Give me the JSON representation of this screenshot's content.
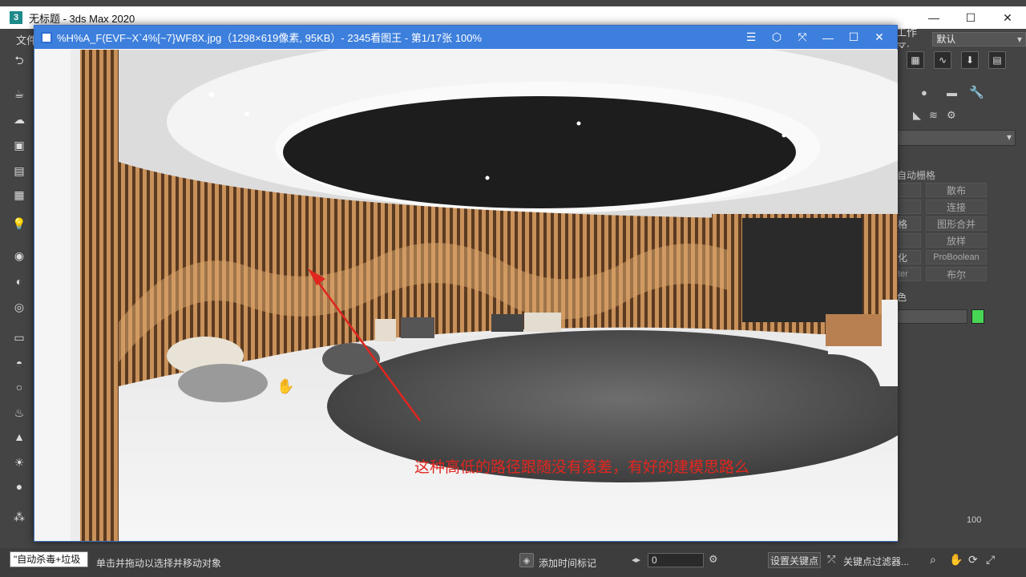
{
  "max_window": {
    "title": "无标题 - 3ds Max 2020",
    "app_icon": "3",
    "menu_first": "文件",
    "workspace_label": "工作区:",
    "workspace_value": "默认",
    "window_buttons": {
      "minimize": "—",
      "maximize": "☐",
      "close": "✕"
    }
  },
  "right_panel": {
    "auto_grid": "自动栅格",
    "buttons": [
      {
        "left": "",
        "right": "散布"
      },
      {
        "left": "",
        "right": "连接"
      },
      {
        "left": "格",
        "right": "图形合并"
      },
      {
        "left": "",
        "right": "放样"
      },
      {
        "left": "化",
        "right": "ProBoolean"
      },
      {
        "left": "ter",
        "right": "布尔"
      }
    ],
    "color_label": "色",
    "color_swatch": "#47d654",
    "timeline_end": "100"
  },
  "status_bar": {
    "script_listener": "\"自动杀毒+垃圾",
    "prompt": "单击并拖动以选择并移动对象",
    "add_time_tag": "添加时间标记",
    "frame_value": "0",
    "set_key": "设置关键点",
    "key_filters": "关键点过滤器..."
  },
  "viewer": {
    "title": "%H%A_F(EVF~X`4%[~7}WF8X.jpg（1298×619像素, 95KB）- 2345看图王 - 第1/17张 100%",
    "title_buttons": {
      "menu": "☰",
      "skin": "⬡",
      "fullscreen": "⤧",
      "minimize": "—",
      "maximize": "☐",
      "close": "✕"
    }
  },
  "annotation_text": "这种高低的路径跟随没有落差，有好的建模思路么",
  "colors": {
    "viewer_titlebar": "#3d7fdc",
    "annotation": "#e0261f",
    "max_background": "#444444"
  }
}
